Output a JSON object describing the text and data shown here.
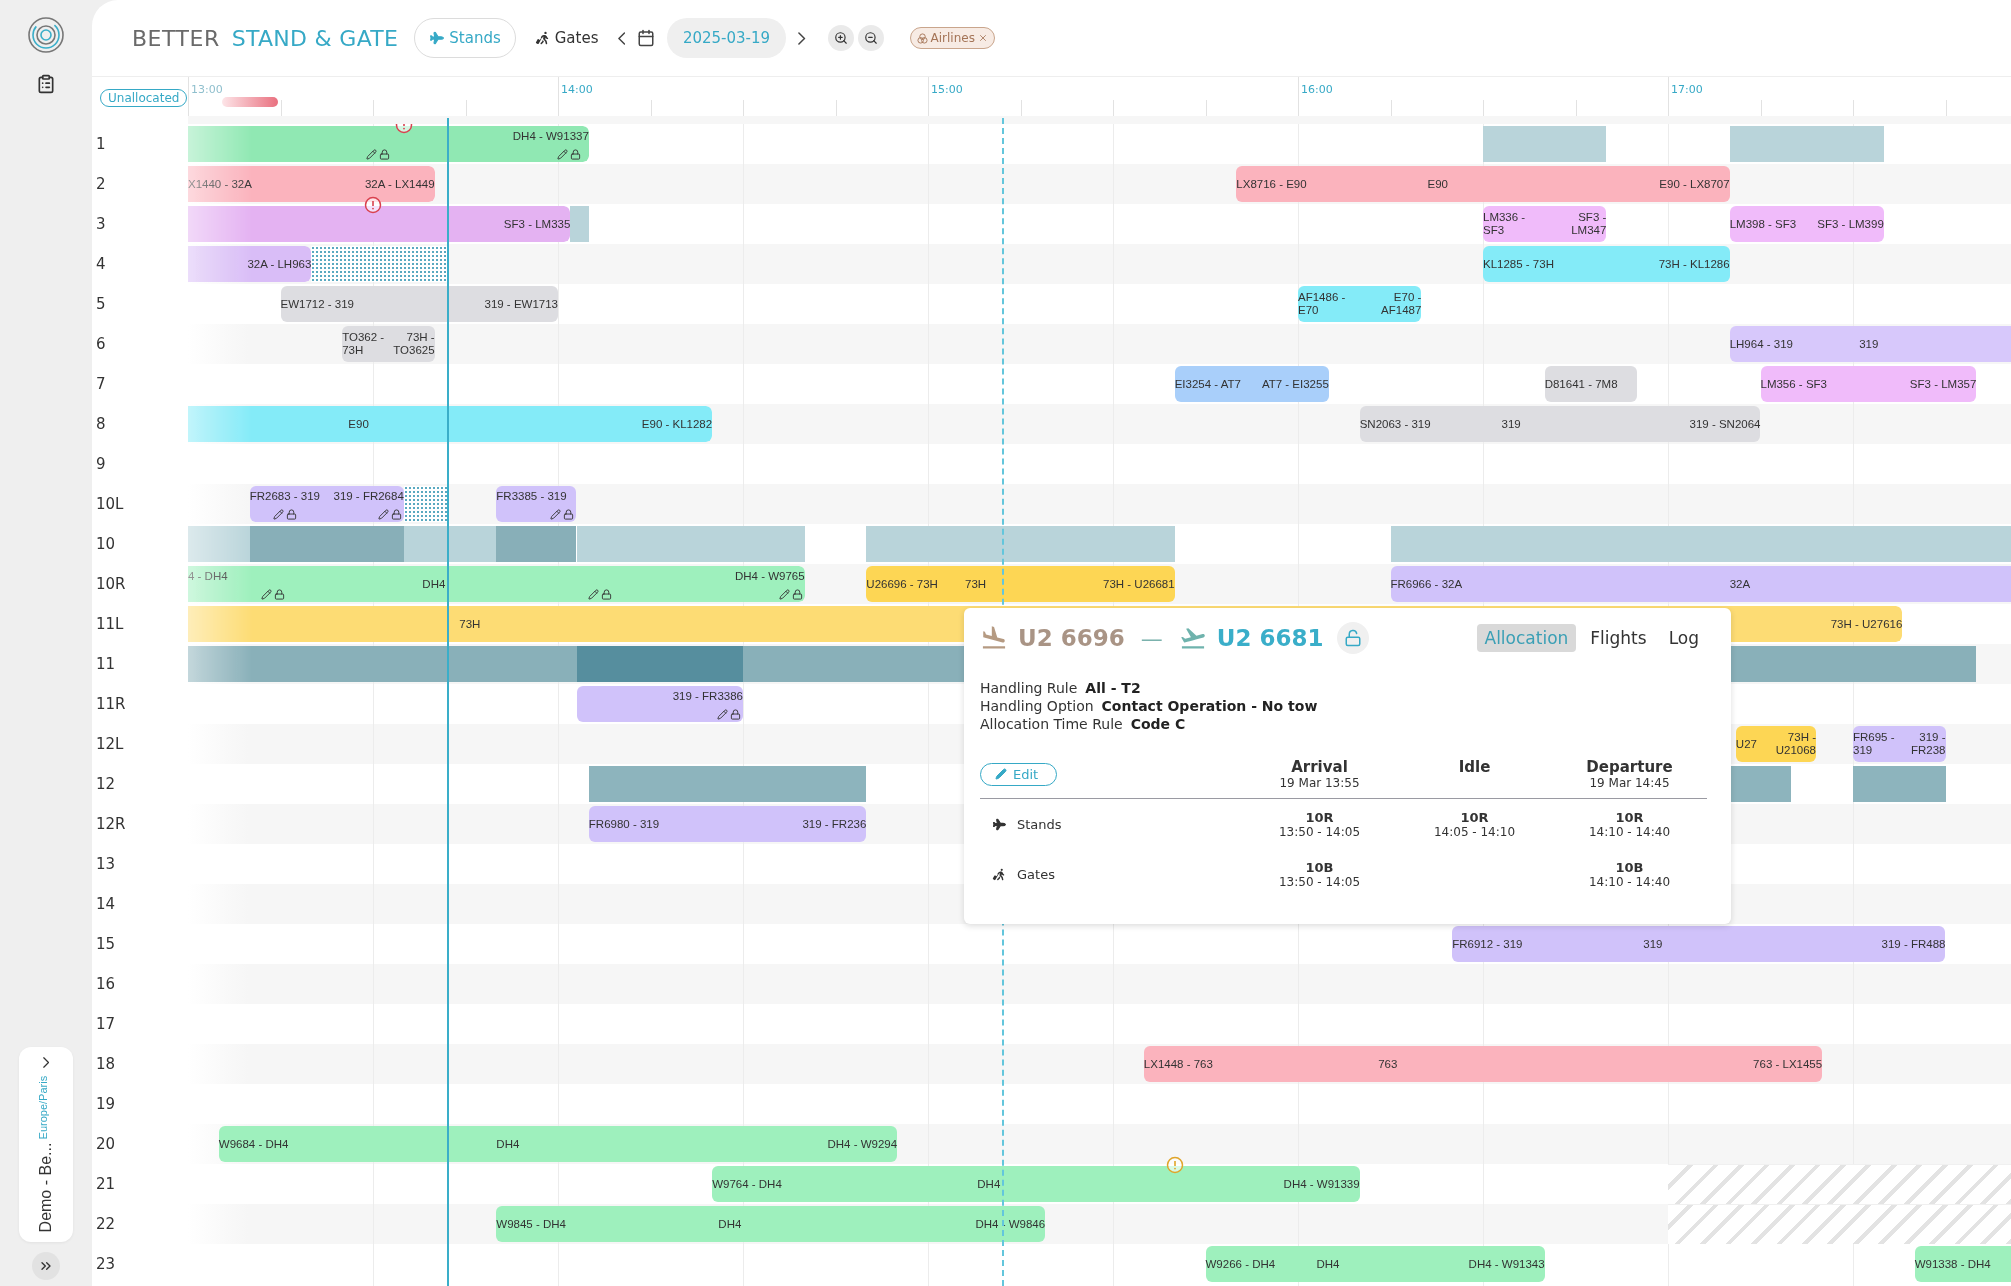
{
  "sidebar": {
    "workspace": {
      "name": "Demo - Be...",
      "timezone": "Europe/Paris"
    }
  },
  "header": {
    "brand_primary": "BETTER",
    "brand_secondary": "STAND & GATE",
    "modes": [
      {
        "label": "Stands",
        "kind": "plane",
        "selected": true
      },
      {
        "label": "Gates",
        "kind": "walker",
        "selected": false
      }
    ],
    "date": "2025-03-19",
    "filters": [
      {
        "label": "Airlines"
      }
    ]
  },
  "timeline": {
    "unallocated": "Unallocated",
    "hours": [
      {
        "label": "13:00",
        "faded": true
      },
      {
        "label": "14:00",
        "faded": false
      },
      {
        "label": "15:00",
        "faded": false
      },
      {
        "label": "16:00",
        "faded": false
      },
      {
        "label": "17:00",
        "faded": false
      }
    ]
  },
  "rows": [
    {
      "label": "1",
      "alerts": [
        {
          "kind": "error"
        }
      ],
      "items": [
        {
          "kind": "flight",
          "color": "#90e8b3",
          "right": "DH4 - W91337"
        },
        {
          "kind": "block",
          "color": "#b9d4da"
        },
        {
          "kind": "block",
          "color": "#b9d4da"
        }
      ]
    },
    {
      "label": "2",
      "items": [
        {
          "kind": "flight",
          "color": "#fbb3bd",
          "left": "X1440 - 32A",
          "right": "32A - LX1449"
        },
        {
          "kind": "flight",
          "color": "#fbb3bd",
          "left": "LX8716 - E90",
          "mid": "E90",
          "right": "E90 - LX8707"
        }
      ]
    },
    {
      "label": "3",
      "alerts": [
        {
          "kind": "error"
        }
      ],
      "items": [
        {
          "kind": "flight",
          "color": "#e4b2f2",
          "right": "SF3 - LM335"
        },
        {
          "kind": "block",
          "color": "#b9d4da"
        },
        {
          "kind": "flight",
          "color": "#f0bbfa",
          "left": "LM336 - SF3",
          "right": "SF3 - LM347"
        },
        {
          "kind": "flight",
          "color": "#f0bbfa",
          "left": "LM398 - SF3",
          "right": "SF3 - LM399"
        }
      ]
    },
    {
      "label": "4",
      "items": [
        {
          "kind": "flight",
          "color": "#d9bdf7",
          "right": "32A - LH963"
        },
        {
          "kind": "dotted"
        },
        {
          "kind": "flight",
          "color": "#84ebf8",
          "left": "KL1285 - 73H",
          "right": "73H - KL1286"
        }
      ]
    },
    {
      "label": "5",
      "items": [
        {
          "kind": "flight",
          "color": "#dddde1",
          "left": "EW1712 - 319",
          "right": "319 - EW1713"
        },
        {
          "kind": "flight",
          "color": "#84ebf8",
          "left": "AF1486 - E70",
          "right": "E70 - AF1487"
        }
      ]
    },
    {
      "label": "6",
      "items": [
        {
          "kind": "flight",
          "color": "#dddde1",
          "left": "TO362 - 73H",
          "right": "73H - TO3625"
        },
        {
          "kind": "flight",
          "color": "#d7c8fb",
          "left": "LH964 - 319",
          "mid": "319"
        }
      ]
    },
    {
      "label": "7",
      "items": [
        {
          "kind": "flight",
          "color": "#a9cffa",
          "left": "EI3254 - AT7",
          "right": "AT7 - EI3255"
        },
        {
          "kind": "flight",
          "color": "#dddde1",
          "left": "D81641 - 7M8"
        },
        {
          "kind": "flight",
          "color": "#f0bbfa",
          "left": "LM356 - SF3",
          "right": "SF3 - LM357"
        }
      ]
    },
    {
      "label": "8",
      "items": [
        {
          "kind": "flight",
          "color": "#84ebf8",
          "mid": "E90",
          "right": "E90 - KL1282"
        },
        {
          "kind": "flight",
          "color": "#dddde1",
          "left": "SN2063 - 319",
          "mid": "319",
          "right": "319 - SN2064"
        }
      ]
    },
    {
      "label": "9",
      "items": []
    },
    {
      "label": "10L",
      "items": [
        {
          "kind": "flight",
          "color": "#d0c2fa",
          "left": "FR2683 - 319",
          "right": "319 - FR2684"
        },
        {
          "kind": "dotted"
        },
        {
          "kind": "flight",
          "color": "#d0c2fa",
          "left": "FR3385 - 319"
        }
      ]
    },
    {
      "label": "10",
      "items": [
        {
          "kind": "block",
          "color": "#b9d4da"
        },
        {
          "kind": "block",
          "color": "#88afb8"
        },
        {
          "kind": "block",
          "color": "#b9d4da"
        },
        {
          "kind": "block",
          "color": "#88afb8"
        },
        {
          "kind": "block",
          "color": "#b9d4da"
        },
        {
          "kind": "block",
          "color": "#b9d4da"
        },
        {
          "kind": "block",
          "color": "#b9d4da"
        }
      ]
    },
    {
      "label": "10R",
      "items": [
        {
          "kind": "flight",
          "color": "#9ef0bd",
          "left": "4 - DH4",
          "mid": "DH4",
          "right": "DH4 - W9765"
        },
        {
          "kind": "flight",
          "color": "#fdd654",
          "left": "U26696 - 73H",
          "mid": "73H",
          "right": "73H - U26681"
        },
        {
          "kind": "flight",
          "color": "#d0c2fa",
          "left": "FR6966 - 32A",
          "mid": "32A"
        }
      ]
    },
    {
      "label": "11L",
      "items": [
        {
          "kind": "flight",
          "color": "#fddc74",
          "mid": "73H",
          "right": "73H - U27616"
        }
      ]
    },
    {
      "label": "11",
      "items": [
        {
          "kind": "block",
          "color": "#89b0b9"
        },
        {
          "kind": "block",
          "color": "#568e9e"
        },
        {
          "kind": "block",
          "color": "#89b0b9"
        }
      ]
    },
    {
      "label": "11R",
      "items": [
        {
          "kind": "flight",
          "color": "#d0c2fa",
          "right": "319 - FR3386"
        }
      ]
    },
    {
      "label": "12L",
      "items": [
        {
          "kind": "flight",
          "color": "#fdd654",
          "left": "U27",
          "right": "73H - U21068"
        },
        {
          "kind": "flight",
          "color": "#d0c2fa",
          "left": "FR695 - 319",
          "right": "319 - FR238"
        }
      ]
    },
    {
      "label": "12",
      "items": [
        {
          "kind": "block",
          "color": "#8db4bd"
        },
        {
          "kind": "block",
          "color": "#8db4bd"
        },
        {
          "kind": "block",
          "color": "#8db4bd"
        }
      ]
    },
    {
      "label": "12R",
      "items": [
        {
          "kind": "flight",
          "color": "#d0c2fa",
          "left": "FR6980 - 319",
          "right": "319 - FR236"
        }
      ]
    },
    {
      "label": "13",
      "items": []
    },
    {
      "label": "14",
      "items": []
    },
    {
      "label": "15",
      "items": [
        {
          "kind": "flight",
          "color": "#d0c2fa",
          "left": "FR6912 - 319",
          "mid": "319",
          "right": "319 - FR488"
        }
      ]
    },
    {
      "label": "16",
      "items": []
    },
    {
      "label": "17",
      "items": []
    },
    {
      "label": "18",
      "items": [
        {
          "kind": "flight",
          "color": "#fbb3bd",
          "left": "LX1448 - 763",
          "mid": "763",
          "right": "763 - LX1455"
        }
      ]
    },
    {
      "label": "19",
      "items": []
    },
    {
      "label": "20",
      "items": [
        {
          "kind": "flight",
          "color": "#9ef0bd",
          "left": "W9684 - DH4",
          "mid": "DH4",
          "right": "DH4 - W9294"
        }
      ]
    },
    {
      "label": "21",
      "alerts": [
        {
          "kind": "warning"
        }
      ],
      "items": [
        {
          "kind": "flight",
          "color": "#9ef0bd",
          "left": "W9764 - DH4",
          "mid": "DH4",
          "right": "DH4 - W91339"
        },
        {
          "kind": "hatched"
        }
      ]
    },
    {
      "label": "22",
      "items": [
        {
          "kind": "flight",
          "color": "#9ef0bd",
          "left": "W9845 - DH4",
          "mid": "DH4",
          "right": "DH4 - W9846"
        },
        {
          "kind": "hatched"
        }
      ]
    },
    {
      "label": "23",
      "items": [
        {
          "kind": "flight",
          "color": "#9ef0bd",
          "left": "W9266 - DH4",
          "mid": "DH4",
          "right": "DH4 - W91343"
        },
        {
          "kind": "flight",
          "color": "#9ef0bd",
          "left": "W91338 - DH4"
        }
      ]
    }
  ],
  "popup": {
    "arrival": "U2 6696",
    "separator": "—",
    "departure": "U2 6681",
    "locked": false,
    "tabs": [
      {
        "label": "Allocation",
        "selected": true
      },
      {
        "label": "Flights",
        "selected": false
      },
      {
        "label": "Log",
        "selected": false
      }
    ],
    "details": [
      {
        "label": "Handling Rule",
        "value": "All - T2"
      },
      {
        "label": "Handling Option",
        "value": "Contact Operation - No tow"
      },
      {
        "label": "Allocation Time Rule",
        "value": "Code C"
      }
    ],
    "edit": "Edit",
    "columns": [
      {
        "title": "Arrival",
        "time": "19 Mar 13:55"
      },
      {
        "title": "Idle"
      },
      {
        "title": "Departure",
        "time": "19 Mar 14:45"
      }
    ],
    "rows": [
      {
        "label": "Stands",
        "kind": "plane",
        "cells": [
          {
            "code": "10R",
            "time": "13:50 - 14:05"
          },
          {
            "code": "10R",
            "time": "14:05 - 14:10"
          },
          {
            "code": "10R",
            "time": "14:10 - 14:40"
          }
        ]
      },
      {
        "label": "Gates",
        "kind": "walker",
        "cells": [
          {
            "code": "10B",
            "time": "13:50 - 14:05"
          },
          null,
          {
            "code": "10B",
            "time": "14:10 - 14:40"
          }
        ]
      }
    ]
  }
}
